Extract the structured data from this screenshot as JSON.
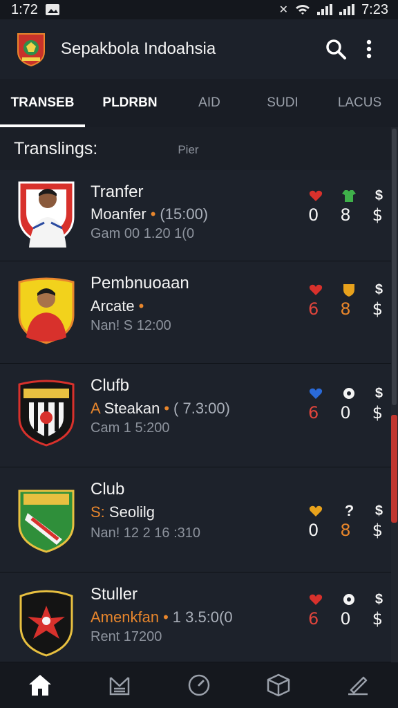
{
  "status_bar": {
    "time_left": "1:72",
    "time_right": "7:23"
  },
  "app_bar": {
    "title": "Sepakbola Indoahsia"
  },
  "tabs": [
    {
      "label": "TRANSEB",
      "active": true
    },
    {
      "label": "PLDRBN",
      "active": false
    },
    {
      "label": "AID",
      "active": false
    },
    {
      "label": "SUDI",
      "active": false
    },
    {
      "label": "LACUS",
      "active": false
    }
  ],
  "section": {
    "title": "Translings:",
    "subtitle": "Pier"
  },
  "items": [
    {
      "crest": "player-photo-red-badge",
      "name": "Tranfer",
      "line2_lead": "",
      "line2_main": "Moanfer",
      "line2_tail": "(15:00)",
      "line3": "Gam 00 1.20 1(0",
      "stat_icons": [
        "red",
        "green",
        "white"
      ],
      "stat_nums": [
        "0",
        "8",
        "$"
      ]
    },
    {
      "crest": "player-photo-yellow-badge",
      "name": "Pembnuoaan",
      "line2_lead": "",
      "line2_main": "Arcate",
      "line2_tail": "",
      "line3": "Nan! S 12:00",
      "stat_icons": [
        "red",
        "orange",
        "white"
      ],
      "stat_nums": [
        "6",
        "8",
        "$"
      ]
    },
    {
      "crest": "black-shield-crest",
      "name": "Clufb",
      "line2_lead": "A",
      "line2_main": "Steakan",
      "line2_tail": "( 7.3:00)",
      "line3": "Cam 1 5:200",
      "stat_icons": [
        "blue",
        "white",
        "white"
      ],
      "stat_nums": [
        "6",
        "0",
        "$"
      ]
    },
    {
      "crest": "green-shield-crest",
      "name": "Club",
      "line2_lead": "S:",
      "line2_main": "Seolilg",
      "line2_tail": "",
      "line3": "Nan! 12 2 16 :310",
      "stat_icons": [
        "orange",
        "white",
        "white"
      ],
      "stat_nums": [
        "0",
        "8",
        "$"
      ]
    },
    {
      "crest": "eagle-round-crest",
      "name": "Stuller",
      "line2_lead": "",
      "line2_main": "Amenkfan",
      "line2_tail": "1 3.5:0(0",
      "line3": "Rent 17200",
      "stat_icons": [
        "red",
        "white",
        "white"
      ],
      "stat_nums": [
        "6",
        "0",
        "$"
      ]
    }
  ],
  "bottom_nav": [
    {
      "icon": "home-icon",
      "active": true
    },
    {
      "icon": "news-icon",
      "active": false
    },
    {
      "icon": "clock-icon",
      "active": false
    },
    {
      "icon": "box-icon",
      "active": false
    },
    {
      "icon": "edit-icon",
      "active": false
    }
  ],
  "colors": {
    "accent": "#e8862c",
    "red": "#e0453c",
    "background": "#1b1f27"
  }
}
